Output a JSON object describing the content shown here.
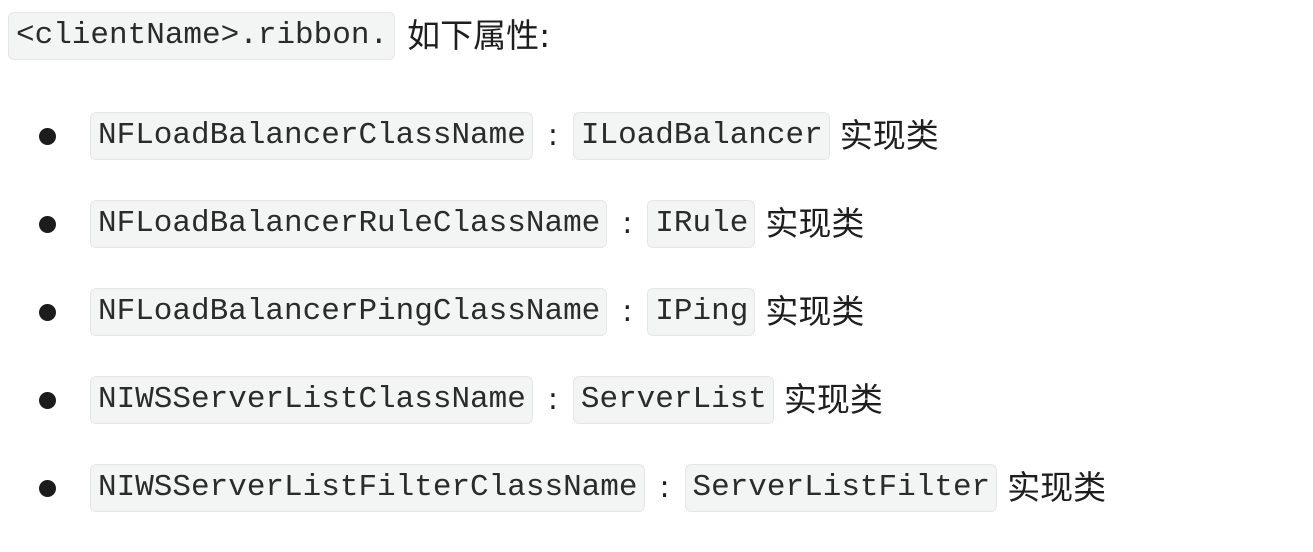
{
  "header": {
    "code": "<clientName>.ribbon.",
    "text": "如下属性:"
  },
  "items": [
    {
      "property": "NFLoadBalancerClassName",
      "separator": ":",
      "type": "ILoadBalancer",
      "suffix": "实现类"
    },
    {
      "property": "NFLoadBalancerRuleClassName",
      "separator": ":",
      "type": "IRule",
      "suffix": "实现类"
    },
    {
      "property": "NFLoadBalancerPingClassName",
      "separator": ":",
      "type": "IPing",
      "suffix": "实现类"
    },
    {
      "property": "NIWSServerListClassName",
      "separator": ":",
      "type": "ServerList",
      "suffix": "实现类"
    },
    {
      "property": "NIWSServerListFilterClassName",
      "separator": ":",
      "type": "ServerListFilter",
      "suffix": "实现类"
    }
  ],
  "colors": {
    "code_background": "#f3f4f4",
    "code_border": "#e4e6e7",
    "text": "#1e1e1e",
    "bullet": "#1c1c1c"
  }
}
